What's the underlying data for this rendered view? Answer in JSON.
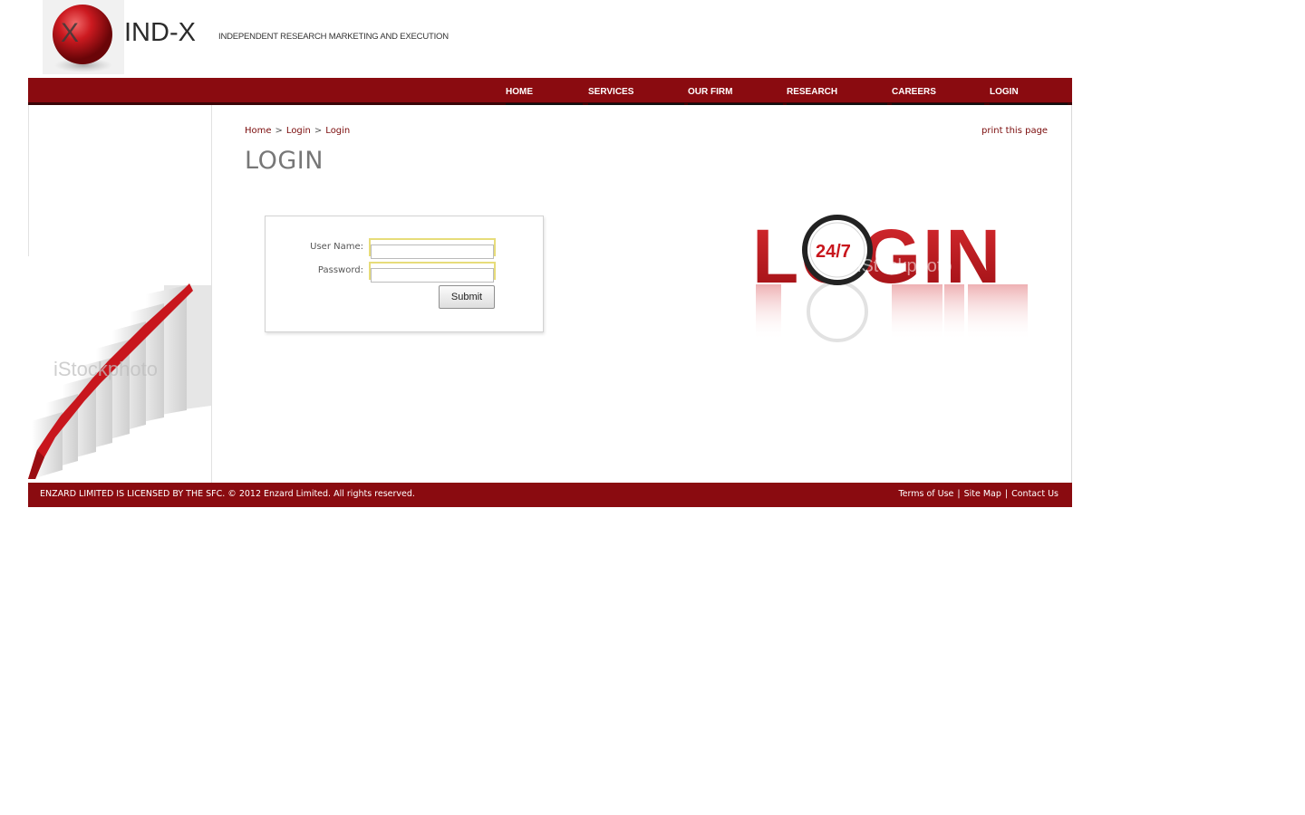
{
  "header": {
    "logo_letter": "X",
    "brand_name": "IND-X",
    "tagline": "INDEPENDENT RESEARCH MARKETING AND EXECUTION",
    "colors": {
      "brand_red": "#8a0b10",
      "logo_red": "#c0151c"
    }
  },
  "nav": {
    "items": [
      {
        "label": "HOME"
      },
      {
        "label": "SERVICES"
      },
      {
        "label": "OUR FIRM"
      },
      {
        "label": "RESEARCH"
      },
      {
        "label": "CAREERS"
      },
      {
        "label": "LOGIN"
      }
    ]
  },
  "breadcrumb": {
    "items": [
      "Home",
      "Login",
      "Login"
    ],
    "separator": ">"
  },
  "print_link": "print this page",
  "page_title": "LOGIN",
  "login_form": {
    "username_label": "User Name:",
    "username_value": "",
    "password_label": "Password:",
    "password_value": "",
    "submit_label": "Submit"
  },
  "images": {
    "left_watermark": "iStockphoto",
    "right_watermark": "iStockphoto",
    "graphic_word": "LOGIN",
    "clock_text": "24/7"
  },
  "footer": {
    "left_text": "ENZARD LIMITED IS LICENSED BY THE SFC. © 2012 Enzard Limited. All rights reserved.",
    "links": [
      "Terms of Use",
      "Site Map",
      "Contact Us"
    ],
    "separator": "|"
  }
}
